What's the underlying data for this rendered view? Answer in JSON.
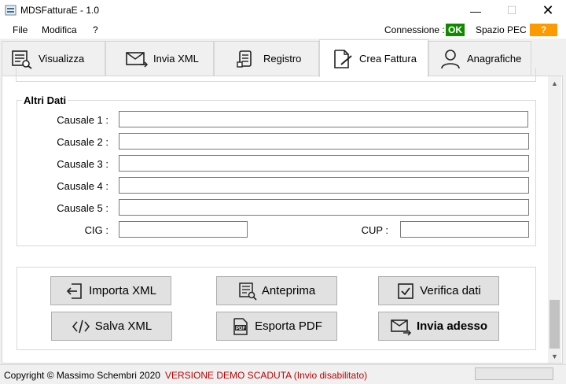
{
  "window": {
    "title": "MDSFatturaE - 1.0",
    "minimize_glyph": "—",
    "maximize_glyph": "☐",
    "close_glyph": "✕"
  },
  "menu": {
    "items": [
      "File",
      "Modifica",
      "?"
    ],
    "connection_label": "Connessione :",
    "connection_status": "OK",
    "pec_label": "Spazio PEC :",
    "pec_status": "?"
  },
  "colors": {
    "connection_ok": "#118a00",
    "pec_unknown": "#ff9900",
    "demo_warning": "#c00000"
  },
  "tabs": [
    {
      "label": "Visualizza",
      "icon": "view-list-icon"
    },
    {
      "label": "Invia XML",
      "icon": "envelope-send-icon"
    },
    {
      "label": "Registro",
      "icon": "register-icon"
    },
    {
      "label": "Crea Fattura",
      "icon": "document-edit-icon",
      "active": true
    },
    {
      "label": "Anagrafiche",
      "icon": "user-icon"
    }
  ],
  "altri_dati": {
    "title": "Altri Dati",
    "fields": [
      {
        "label": "Causale 1 :",
        "value": ""
      },
      {
        "label": "Causale 2 :",
        "value": ""
      },
      {
        "label": "Causale 3 :",
        "value": ""
      },
      {
        "label": "Causale 4 :",
        "value": ""
      },
      {
        "label": "Causale 5 :",
        "value": ""
      }
    ],
    "cig_label": "CIG :",
    "cig_value": "",
    "cup_label": "CUP :",
    "cup_value": ""
  },
  "actions": {
    "importa_xml": "Importa XML",
    "anteprima": "Anteprima",
    "verifica_dati": "Verifica dati",
    "salva_xml": "Salva XML",
    "esporta_pdf": "Esporta PDF",
    "invia_adesso": "Invia adesso"
  },
  "status": {
    "copyright": "Copyright © Massimo Schembri 2020",
    "demo_warning": "VERSIONE DEMO SCADUTA (Invio disabilitato)"
  }
}
